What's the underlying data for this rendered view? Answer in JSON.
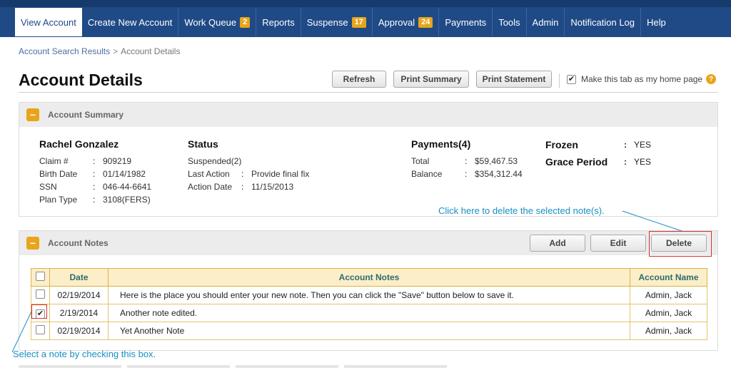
{
  "nav": {
    "items": [
      {
        "label": "View Account",
        "badge": null,
        "active": true
      },
      {
        "label": "Create New Account",
        "badge": null,
        "active": false
      },
      {
        "label": "Work Queue",
        "badge": "2",
        "active": false
      },
      {
        "label": "Reports",
        "badge": null,
        "active": false
      },
      {
        "label": "Suspense",
        "badge": "17",
        "active": false
      },
      {
        "label": "Approval",
        "badge": "24",
        "active": false
      },
      {
        "label": "Payments",
        "badge": null,
        "active": false
      },
      {
        "label": "Tools",
        "badge": null,
        "active": false
      },
      {
        "label": "Admin",
        "badge": null,
        "active": false
      },
      {
        "label": "Notification Log",
        "badge": null,
        "active": false
      },
      {
        "label": "Help",
        "badge": null,
        "active": false
      }
    ]
  },
  "breadcrumb": {
    "link": "Account Search Results",
    "separator": ">",
    "current": "Account Details"
  },
  "page": {
    "title": "Account Details",
    "refresh_label": "Refresh",
    "print_summary_label": "Print Summary",
    "print_statement_label": "Print Statement",
    "home_label": "Make this tab as my home page",
    "home_checked": true,
    "help_symbol": "?"
  },
  "summary": {
    "title": "Account Summary",
    "collapse_symbol": "−",
    "name": "Rachel Gonzalez",
    "fields": [
      {
        "label": "Claim #",
        "value": "909219"
      },
      {
        "label": "Birth Date",
        "value": "01/14/1982"
      },
      {
        "label": "SSN",
        "value": "046-44-6641"
      },
      {
        "label": "Plan Type",
        "value": "3108(FERS)"
      }
    ],
    "status_head": "Status",
    "status_value": "Suspended(2)",
    "status_fields": [
      {
        "label": "Last Action",
        "value": "Provide final fix"
      },
      {
        "label": "Action Date",
        "value": "11/15/2013"
      }
    ],
    "payments_head": "Payments(4)",
    "payments_fields": [
      {
        "label": "Total",
        "value": "$59,467.53"
      },
      {
        "label": "Balance",
        "value": "$354,312.44"
      }
    ],
    "flags": [
      {
        "label": "Frozen",
        "value": "YES"
      },
      {
        "label": "Grace Period",
        "value": "YES"
      }
    ],
    "colon": ":"
  },
  "notes": {
    "title": "Account Notes",
    "collapse_symbol": "−",
    "add_label": "Add",
    "edit_label": "Edit",
    "delete_label": "Delete",
    "columns": [
      "Date",
      "Account Notes",
      "Account Name"
    ],
    "rows": [
      {
        "date": "02/19/2014",
        "note": "Here is the place you should enter your new note. Then you can click the \"Save\" button below to save it.",
        "name": "Admin, Jack",
        "checked": false
      },
      {
        "date": "2/19/2014",
        "note": "Another note edited.",
        "name": "Admin, Jack",
        "checked": true
      },
      {
        "date": "02/19/2014",
        "note": "Yet Another Note",
        "name": "Admin, Jack",
        "checked": false
      }
    ]
  },
  "callouts": {
    "delete_hint": "Click here to delete the selected note(s).",
    "select_hint": "Select a note by checking this box."
  },
  "colors": {
    "nav_bg": "#1f4a86",
    "accent": "#e8a51a",
    "callout": "#1a8fc4",
    "highlight_box": "#d93030"
  }
}
